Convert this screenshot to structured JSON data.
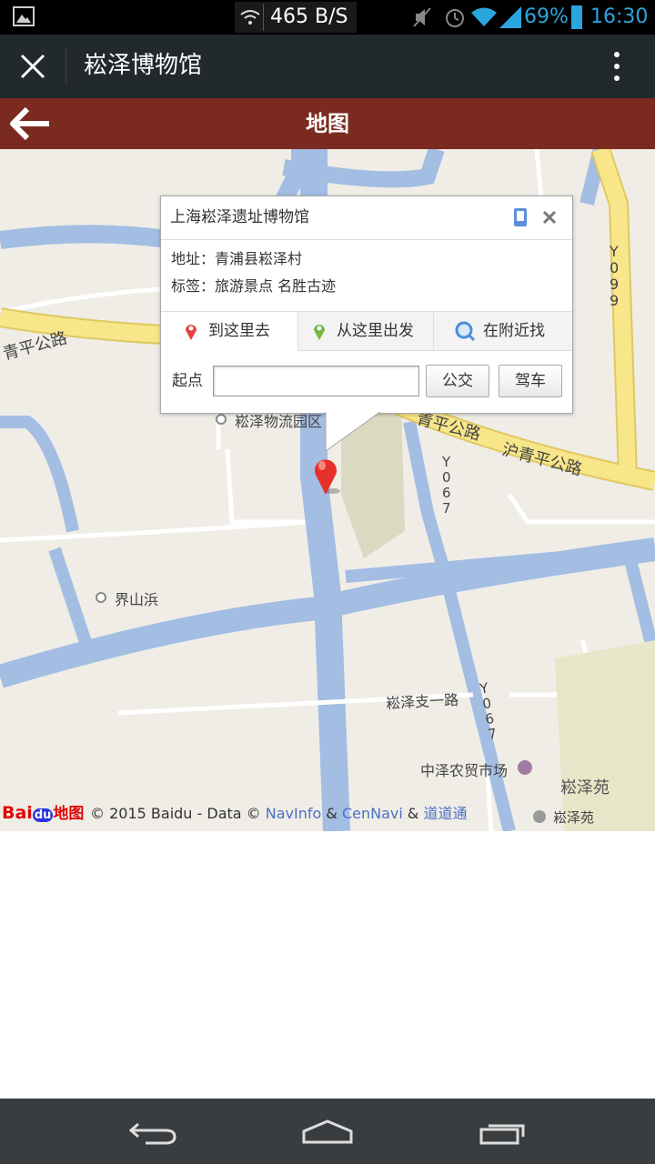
{
  "status_bar": {
    "speed": "465 B/S",
    "battery": "69%",
    "time": "16:30"
  },
  "title_bar": {
    "title": "崧泽博物馆"
  },
  "page_header": {
    "title": "地图"
  },
  "map": {
    "labels": {
      "road_qingping_left": "青平公路",
      "road_qingping_right": "青平公路",
      "road_huqingping": "沪青平公路",
      "y099": "Y099",
      "y067a": "Y067",
      "y067b": "Y067",
      "poi_songze_park": "崧泽物流园区",
      "poi_jieshanbang": "界山浜",
      "road_songze_branch": "崧泽支一路",
      "poi_market": "中泽农贸市场",
      "area_songzeyuan": "崧泽苑",
      "poi_songzeyuan": "崧泽苑"
    },
    "attribution": {
      "brand_bai": "Bai",
      "brand_du": "du",
      "brand_map": "地图",
      "copyright": "© 2015 Baidu - Data ©",
      "navinfo": "NavInfo",
      "amp1": "&",
      "cennavi": "CenNavi",
      "amp2": "&",
      "daodaotong": "道道通"
    }
  },
  "popup": {
    "title": "上海崧泽遗址博物馆",
    "address_label": "地址：",
    "address": "青浦县崧泽村",
    "tags_label": "标签：",
    "tags": "旅游景点 名胜古迹",
    "tabs": [
      "到这里去",
      "从这里出发",
      "在附近找"
    ],
    "start_label": "起点",
    "start_value": "",
    "bus_button": "公交",
    "drive_button": "驾车"
  },
  "colors": {
    "status_bg": "#000000",
    "title_bg": "#22292c",
    "header_bg": "#7b2a20",
    "map_bg": "#efede6",
    "water": "#a3bde3",
    "highway": "#f7e68a",
    "marker": "#e8302a",
    "nav_bg": "#3a3d40"
  }
}
